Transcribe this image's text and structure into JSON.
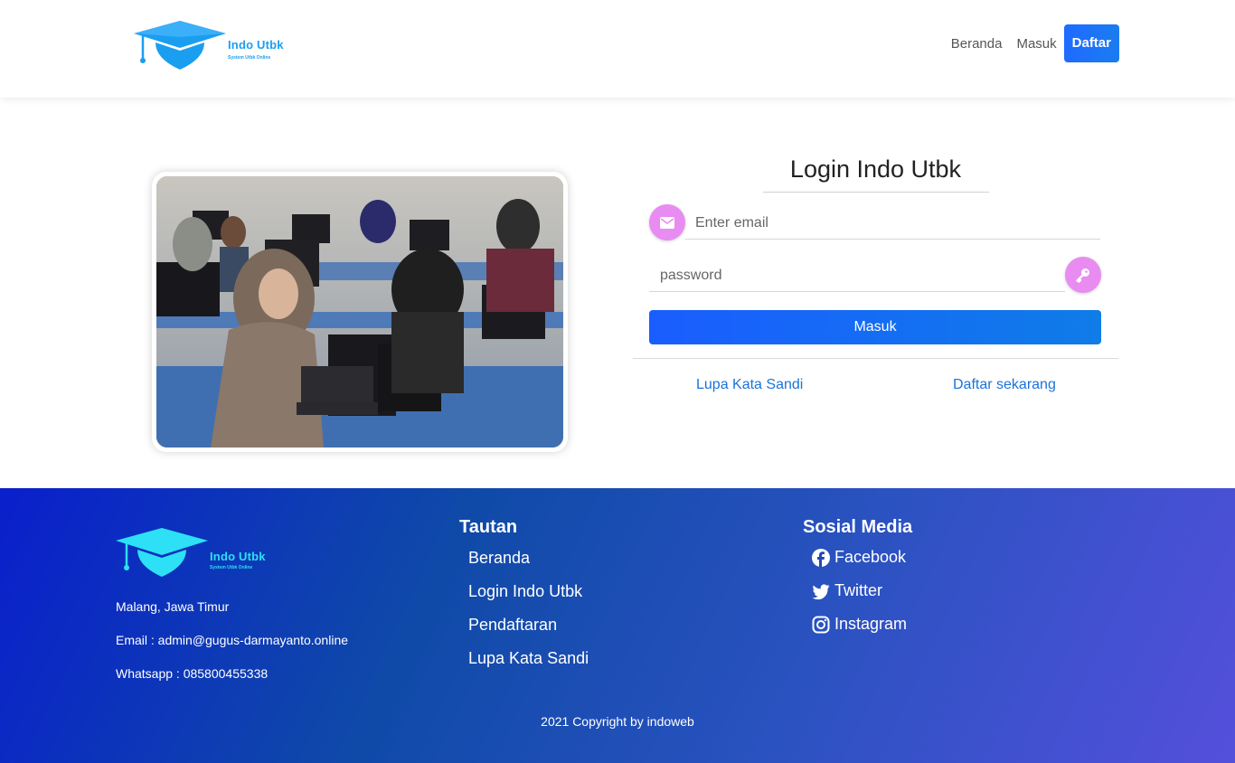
{
  "nav": {
    "brand_name": "Indo Utbk",
    "brand_sub": "System Utbk Online",
    "links": [
      "Beranda",
      "Masuk"
    ],
    "cta_label": "Daftar"
  },
  "login": {
    "title": "Login Indo Utbk",
    "email_placeholder": "Enter email",
    "password_placeholder": "password",
    "submit_label": "Masuk",
    "forgot_label": "Lupa Kata Sandi",
    "register_label": "Daftar sekarang"
  },
  "footer": {
    "brand_name": "Indo Utbk",
    "brand_sub": "System Utbk Online",
    "address": "Malang, Jawa Timur",
    "email": "Email : admin@gugus-darmayanto.online",
    "whatsapp": "Whatsapp :  085800455338",
    "links_title": "Tautan",
    "links": [
      "Beranda",
      "Login Indo Utbk",
      "Pendaftaran",
      "Lupa Kata Sandi"
    ],
    "social_title": "Sosial Media",
    "social": [
      {
        "label": "Facebook",
        "icon": "facebook-icon"
      },
      {
        "label": "Twitter",
        "icon": "twitter-icon"
      },
      {
        "label": "Instagram",
        "icon": "instagram-icon"
      }
    ],
    "copyright": "2021 Copyright by indoweb"
  },
  "colors": {
    "primary": "#0d6efd",
    "icon_bg": "#e88cf2",
    "brand": "#1a9ef0",
    "footer_brand": "#2de0f5"
  }
}
